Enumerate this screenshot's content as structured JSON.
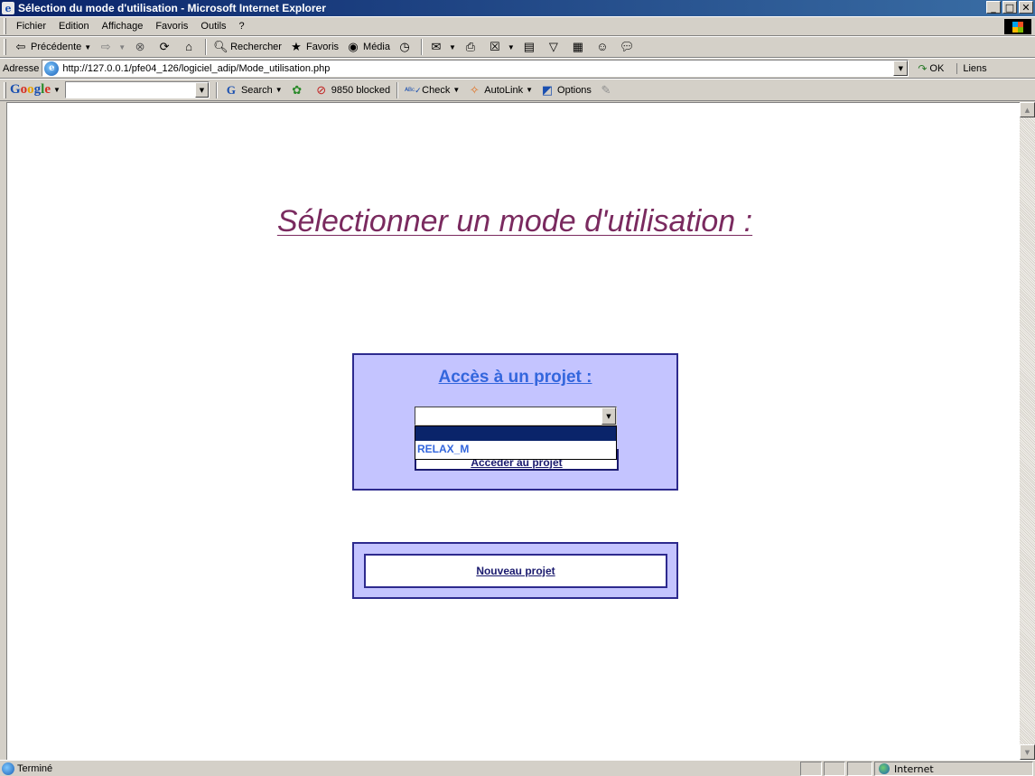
{
  "window": {
    "title": "Sélection du mode d'utilisation - Microsoft Internet Explorer",
    "buttons": [
      "_",
      "□",
      "✕"
    ]
  },
  "menu": [
    "Fichier",
    "Edition",
    "Affichage",
    "Favoris",
    "Outils",
    "?"
  ],
  "toolbar": {
    "back_label": "Précédente",
    "search_label": "Rechercher",
    "favorites_label": "Favoris",
    "media_label": "Média"
  },
  "address": {
    "label": "Adresse",
    "url": "http://127.0.0.1/pfe04_126/logiciel_adip/Mode_utilisation.php",
    "go_label": "OK",
    "links_label": "Liens"
  },
  "google_toolbar": {
    "logo": "Google",
    "search_label": "Search",
    "blocked_label": "9850 blocked",
    "check_label": "Check",
    "autolink_label": "AutoLink",
    "options_label": "Options"
  },
  "page": {
    "title": "Sélectionner un mode d'utilisation :",
    "access_heading": "Accès à un projet :",
    "project_select_value": "",
    "project_options": [
      "",
      "RELAX_M"
    ],
    "access_button_label": "Accéder au projet",
    "new_project_label": "Nouveau projet"
  },
  "status": {
    "text": "Terminé",
    "zone": "Internet"
  },
  "colors": {
    "title_color": "#7a2a5f",
    "panel_bg": "#c4c4ff",
    "panel_border": "#2d2a8e",
    "heading_color": "#3366dd"
  }
}
